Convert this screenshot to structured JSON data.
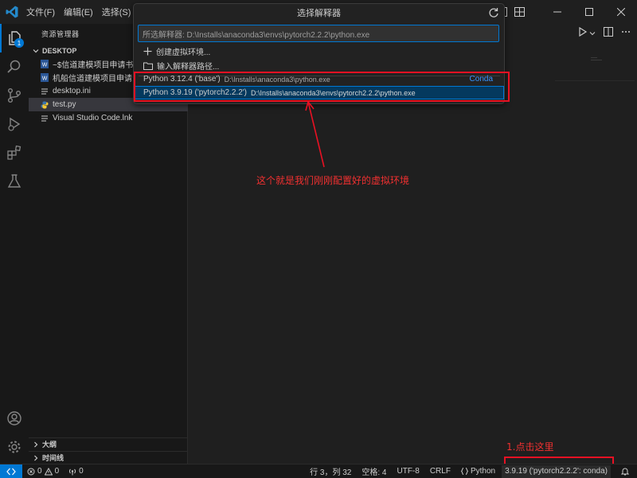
{
  "menu": [
    "文件(F)",
    "编辑(E)",
    "选择(S)"
  ],
  "sidebar": {
    "title": "资源管理器",
    "section": "DESKTOP",
    "files": [
      {
        "name": "~$信道建模项目申请书...",
        "icon": "word-doc-icon"
      },
      {
        "name": "机船信道建模项目申请...",
        "icon": "word-doc-icon"
      },
      {
        "name": "desktop.ini",
        "icon": "settings-file-icon"
      },
      {
        "name": "test.py",
        "icon": "python-file-icon",
        "selected": true
      },
      {
        "name": "Visual Studio Code.lnk",
        "icon": "link-file-icon"
      }
    ],
    "outline": "大纲",
    "timeline": "时间线"
  },
  "quickpick": {
    "title": "选择解释器",
    "input_value": "所选解释器: D:\\Installs\\anaconda3\\envs\\pytorch2.2.2\\python.exe",
    "actions": [
      {
        "label": "创建虚拟环境...",
        "icon": "plus-icon"
      },
      {
        "label": "输入解释器路径...",
        "icon": "folder-icon"
      }
    ],
    "interpreters": [
      {
        "label": "Python 3.12.4 ('base')",
        "path": "D:\\Installs\\anaconda3\\python.exe",
        "tag": "Conda"
      },
      {
        "label": "Python 3.9.19 ('pytorch2.2.2')",
        "path": "D:\\Installs\\anaconda3\\envs\\pytorch2.2.2\\python.exe",
        "selected": true
      }
    ]
  },
  "annotations": {
    "arrow_text": "这个就是我们刚刚配置好的虚拟环境",
    "click_text": "1.点击这里"
  },
  "statusbar": {
    "errors": "0",
    "warnings": "0",
    "ports": "0",
    "position": "行 3，列 32",
    "spaces": "空格: 4",
    "encoding": "UTF-8",
    "eol": "CRLF",
    "language": "Python",
    "interpreter": "3.9.19 ('pytorch2.2.2': conda)"
  },
  "colors": {
    "accent": "#0078d4",
    "annotation": "#e81123",
    "selection": "#04395e"
  }
}
